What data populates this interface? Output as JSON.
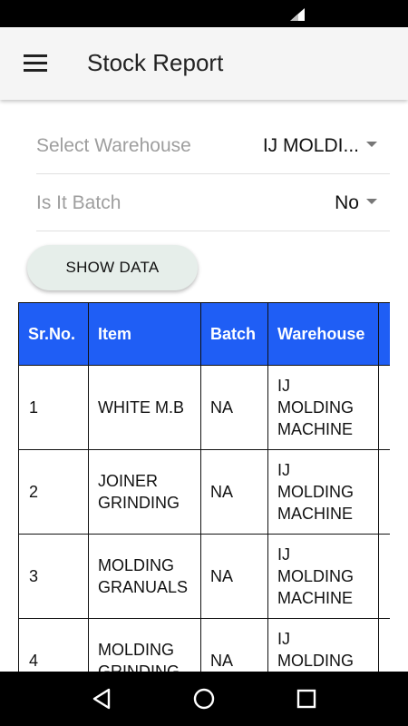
{
  "app_bar": {
    "title": "Stock Report"
  },
  "filters": {
    "warehouse": {
      "label": "Select Warehouse",
      "value": "IJ MOLDI..."
    },
    "batch": {
      "label": "Is It Batch",
      "value": "No"
    }
  },
  "actions": {
    "show_data": "SHOW DATA"
  },
  "table": {
    "headers": [
      "Sr.No.",
      "Item",
      "Batch",
      "Warehouse",
      ""
    ],
    "rows": [
      {
        "sr": "1",
        "item": "WHITE M.B",
        "batch": "NA",
        "warehouse": "IJ MOLDING MACHINE"
      },
      {
        "sr": "2",
        "item": "JOINER GRINDING",
        "batch": "NA",
        "warehouse": "IJ MOLDING MACHINE"
      },
      {
        "sr": "3",
        "item": "MOLDING GRANUALS",
        "batch": "NA",
        "warehouse": "IJ MOLDING MACHINE"
      },
      {
        "sr": "4",
        "item": "MOLDING GRINDING",
        "batch": "NA",
        "warehouse": "IJ MOLDING MACHINE"
      }
    ]
  },
  "colors": {
    "header_bg": "#1f5ef5",
    "button_bg": "#e6eeea"
  },
  "icons": {
    "menu": "menu-icon",
    "dropdown": "caret-down-icon",
    "signal": "signal-icon",
    "back": "back-icon",
    "home": "home-icon",
    "recents": "recents-icon"
  }
}
